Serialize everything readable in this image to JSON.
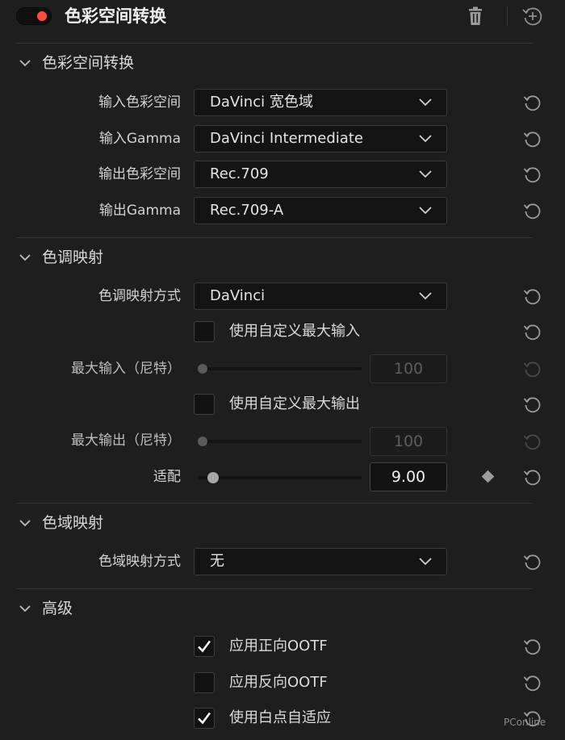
{
  "header": {
    "title": "色彩空间转换",
    "toggle_on": true,
    "toggle_color": "#ff4a45",
    "icons": [
      "trash-icon",
      "reset-all-icon"
    ]
  },
  "sections": {
    "color_space": {
      "title": "色彩空间转换",
      "input_color_space": {
        "label": "输入色彩空间",
        "value": "DaVinci 宽色域"
      },
      "input_gamma": {
        "label": "输入Gamma",
        "value": "DaVinci Intermediate"
      },
      "output_color_space": {
        "label": "输出色彩空间",
        "value": "Rec.709"
      },
      "output_gamma": {
        "label": "输出Gamma",
        "value": "Rec.709-A"
      }
    },
    "tone_mapping": {
      "title": "色调映射",
      "method": {
        "label": "色调映射方式",
        "value": "DaVinci"
      },
      "custom_max_input": {
        "label": "使用自定义最大输入",
        "checked": false
      },
      "max_input": {
        "label": "最大输入（尼特）",
        "value": "100",
        "disabled": true,
        "level": 0
      },
      "custom_max_output": {
        "label": "使用自定义最大输出",
        "checked": false
      },
      "max_output": {
        "label": "最大输出（尼特）",
        "value": "100",
        "disabled": true,
        "level": 0
      },
      "adaptation": {
        "label": "适配",
        "value": "9.00",
        "level": 0.09
      }
    },
    "gamut_mapping": {
      "title": "色域映射",
      "method": {
        "label": "色域映射方式",
        "value": "无"
      }
    },
    "advanced": {
      "title": "高级",
      "forward_ootf": {
        "label": "应用正向OOTF",
        "checked": true
      },
      "inverse_ootf": {
        "label": "应用反向OOTF",
        "checked": false
      },
      "white_point_adapt": {
        "label": "使用白点自适应",
        "checked": true
      }
    }
  },
  "watermark": "PConline"
}
